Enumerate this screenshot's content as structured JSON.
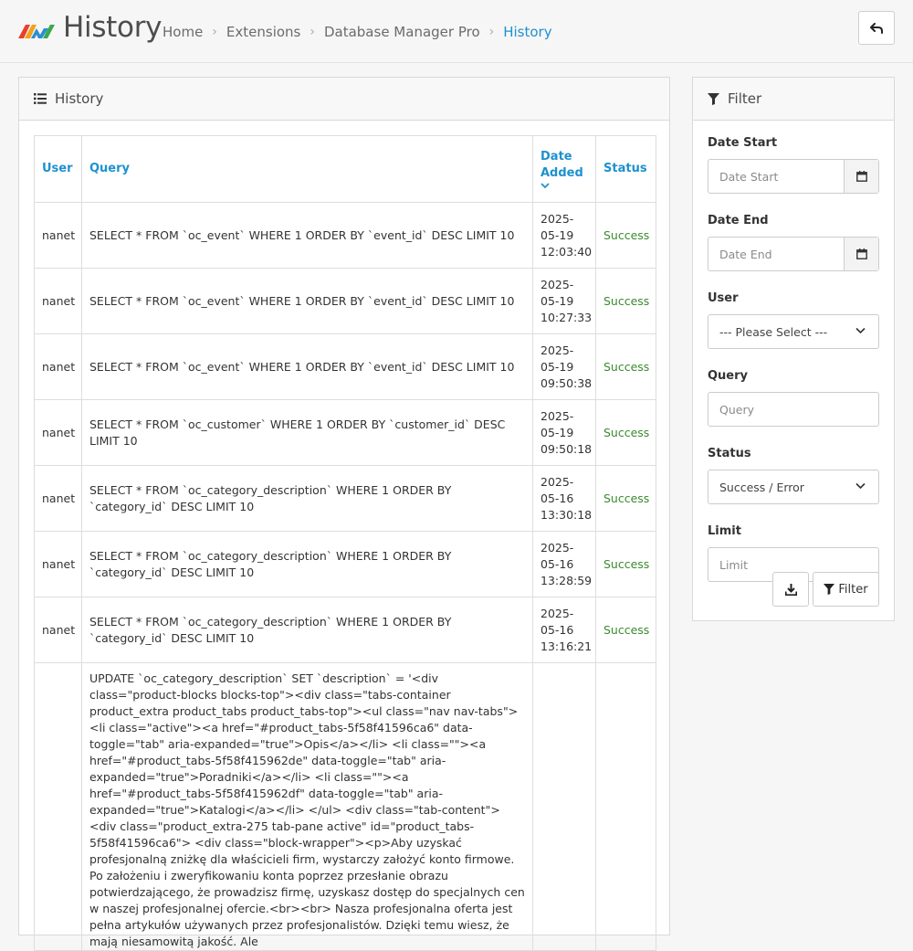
{
  "header": {
    "title": "History",
    "breadcrumb": [
      "Home",
      "Extensions",
      "Database Manager Pro",
      "History"
    ]
  },
  "history_panel": {
    "title": "History",
    "columns": {
      "user": "User",
      "query": "Query",
      "date": "Date Added",
      "status": "Status"
    },
    "rows": [
      {
        "user": "nanet",
        "query": "SELECT * FROM `oc_event` WHERE 1 ORDER BY `event_id` DESC LIMIT 10",
        "date": "2025-05-19 12:03:40",
        "status": "Success"
      },
      {
        "user": "nanet",
        "query": "SELECT * FROM `oc_event` WHERE 1 ORDER BY `event_id` DESC LIMIT 10",
        "date": "2025-05-19 10:27:33",
        "status": "Success"
      },
      {
        "user": "nanet",
        "query": "SELECT * FROM `oc_event` WHERE 1 ORDER BY `event_id` DESC LIMIT 10",
        "date": "2025-05-19 09:50:38",
        "status": "Success"
      },
      {
        "user": "nanet",
        "query": "SELECT * FROM `oc_customer` WHERE 1 ORDER BY `customer_id` DESC LIMIT 10",
        "date": "2025-05-19 09:50:18",
        "status": "Success"
      },
      {
        "user": "nanet",
        "query": "SELECT * FROM `oc_category_description` WHERE 1 ORDER BY `category_id` DESC LIMIT 10",
        "date": "2025-05-16 13:30:18",
        "status": "Success"
      },
      {
        "user": "nanet",
        "query": "SELECT * FROM `oc_category_description` WHERE 1 ORDER BY `category_id` DESC LIMIT 10",
        "date": "2025-05-16 13:28:59",
        "status": "Success"
      },
      {
        "user": "nanet",
        "query": "SELECT * FROM `oc_category_description` WHERE 1 ORDER BY `category_id` DESC LIMIT 10",
        "date": "2025-05-16 13:16:21",
        "status": "Success"
      },
      {
        "user": "",
        "query": "UPDATE `oc_category_description` SET `description` = '<div class=\"product-blocks blocks-top\"><div class=\"tabs-container product_extra product_tabs product_tabs-top\"><ul class=\"nav nav-tabs\"><li class=\"active\"><a href=\"#product_tabs-5f58f41596ca6\" data-toggle=\"tab\" aria-expanded=\"true\">Opis</a></li> <li class=\"\"><a href=\"#product_tabs-5f58f415962de\" data-toggle=\"tab\" aria-expanded=\"true\">Poradniki</a></li> <li class=\"\"><a href=\"#product_tabs-5f58f415962df\" data-toggle=\"tab\" aria-expanded=\"true\">Katalogi</a></li> </ul> <div class=\"tab-content\"><div class=\"product_extra-275 tab-pane active\" id=\"product_tabs-5f58f41596ca6\"> <div class=\"block-wrapper\"><p>Aby uzyskać profesjonalną zniżkę dla właścicieli firm, wystarczy założyć konto firmowe. Po założeniu i zweryfikowaniu konta poprzez przesłanie obrazu potwierdzającego, że prowadzisz firmę, uzyskasz dostęp do specjalnych cen w naszej profesjonalnej ofercie.<br><br> Nasza profesjonalna oferta jest pełna artykułów używanych przez profesjonalistów. Dzięki temu wiesz, że mają niesamowitą jakość. Ale",
        "date": "",
        "status": ""
      }
    ]
  },
  "filter_panel": {
    "title": "Filter",
    "date_start": {
      "label": "Date Start",
      "placeholder": "Date Start"
    },
    "date_end": {
      "label": "Date End",
      "placeholder": "Date End"
    },
    "user": {
      "label": "User",
      "value": "--- Please Select ---"
    },
    "query": {
      "label": "Query",
      "placeholder": "Query"
    },
    "status": {
      "label": "Status",
      "value": "Success / Error"
    },
    "limit": {
      "label": "Limit",
      "placeholder": "Limit"
    },
    "filter_button": "Filter"
  },
  "icons": {
    "logo": "brand-logo",
    "back": "reply-icon",
    "list": "list-icon",
    "filter": "filter-icon",
    "calendar": "calendar-icon",
    "download": "download-icon",
    "caret": "chevron-down-icon"
  },
  "colors": {
    "accent": "#1e91cf",
    "success": "#3b8a2f"
  }
}
